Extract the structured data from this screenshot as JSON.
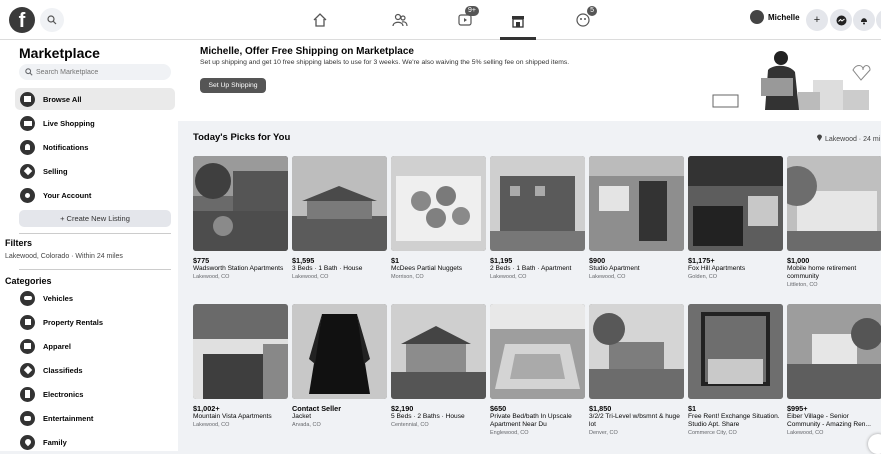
{
  "topbar": {
    "logo_letter": "f",
    "video_badge": "9+",
    "gaming_badge": "5",
    "user_name": "Michelle",
    "add_label": "+"
  },
  "sidebar": {
    "title": "Marketplace",
    "search_placeholder": "Search Marketplace",
    "nav": [
      {
        "label": "Browse All",
        "icon": "storefront-icon"
      },
      {
        "label": "Live Shopping",
        "icon": "live-video-icon"
      },
      {
        "label": "Notifications",
        "icon": "bell-icon"
      },
      {
        "label": "Selling",
        "icon": "tag-icon"
      },
      {
        "label": "Your Account",
        "icon": "person-icon"
      }
    ],
    "create_listing": "+ Create New Listing",
    "filters_heading": "Filters",
    "filters_location": "Lakewood, Colorado · Within 24 miles",
    "categories_heading": "Categories",
    "categories": [
      {
        "label": "Vehicles",
        "icon": "car-icon"
      },
      {
        "label": "Property Rentals",
        "icon": "house-icon"
      },
      {
        "label": "Apparel",
        "icon": "shirt-icon"
      },
      {
        "label": "Classifieds",
        "icon": "tag-icon"
      },
      {
        "label": "Electronics",
        "icon": "phone-icon"
      },
      {
        "label": "Entertainment",
        "icon": "people-icon"
      },
      {
        "label": "Family",
        "icon": "heart-icon"
      }
    ]
  },
  "banner": {
    "title": "Michelle, Offer Free Shipping on Marketplace",
    "subtitle": "Set up shipping and get 10 free shipping labels to use for 3 weeks. We're also waiving the 5% selling fee on shipped items.",
    "button": "Set Up Shipping"
  },
  "picks": {
    "heading": "Today's Picks for You",
    "location": "Lakewood · 24 mi"
  },
  "listings": [
    {
      "price": "$775",
      "title": "Wadsworth Station Apartments",
      "location": "Lakewood, CO",
      "img": "apartment-trees"
    },
    {
      "price": "$1,595",
      "title": "3 Beds · 1 Bath · House",
      "location": "Lakewood, CO",
      "img": "house"
    },
    {
      "price": "$1",
      "title": "McDees Partial Nuggets",
      "location": "Morrison, CO",
      "img": "nuggets"
    },
    {
      "price": "$1,195",
      "title": "2 Beds · 1 Bath · Apartment",
      "location": "Lakewood, CO",
      "img": "apartment-building"
    },
    {
      "price": "$900",
      "title": "Studio Apartment",
      "location": "Lakewood, CO",
      "img": "door"
    },
    {
      "price": "$1,175+",
      "title": "Fox Hill Apartments",
      "location": "Golden, CO",
      "img": "kitchen"
    },
    {
      "price": "$1,000",
      "title": "Mobile home retirement community",
      "location": "Littleton, CO",
      "img": "mobile-home"
    },
    {
      "price": "$1,002+",
      "title": "Mountain Vista Apartments",
      "location": "Lakewood, CO",
      "img": "white-kitchen"
    },
    {
      "price": "Contact Seller",
      "title": "Jacket",
      "location": "Arvada, CO",
      "img": "jacket"
    },
    {
      "price": "$2,190",
      "title": "5 Beds · 2 Baths · House",
      "location": "Centennial, CO",
      "img": "house2"
    },
    {
      "price": "$650",
      "title": "Private Bed/bath In Upscale Apartment Near Du",
      "location": "Englewood, CO",
      "img": "pool"
    },
    {
      "price": "$1,850",
      "title": "3/2/2 Tri-Level w/bsmnt & huge lot",
      "location": "Denver, CO",
      "img": "trilevel"
    },
    {
      "price": "$1",
      "title": "Free Rent! Exchange Situation. Studio Apt. Share",
      "location": "Commerce City, CO",
      "img": "bedroom"
    },
    {
      "price": "$995+",
      "title": "Eiber Village - Senior Community - Amazing Ren...",
      "location": "Lakewood, CO",
      "img": "sign"
    }
  ]
}
